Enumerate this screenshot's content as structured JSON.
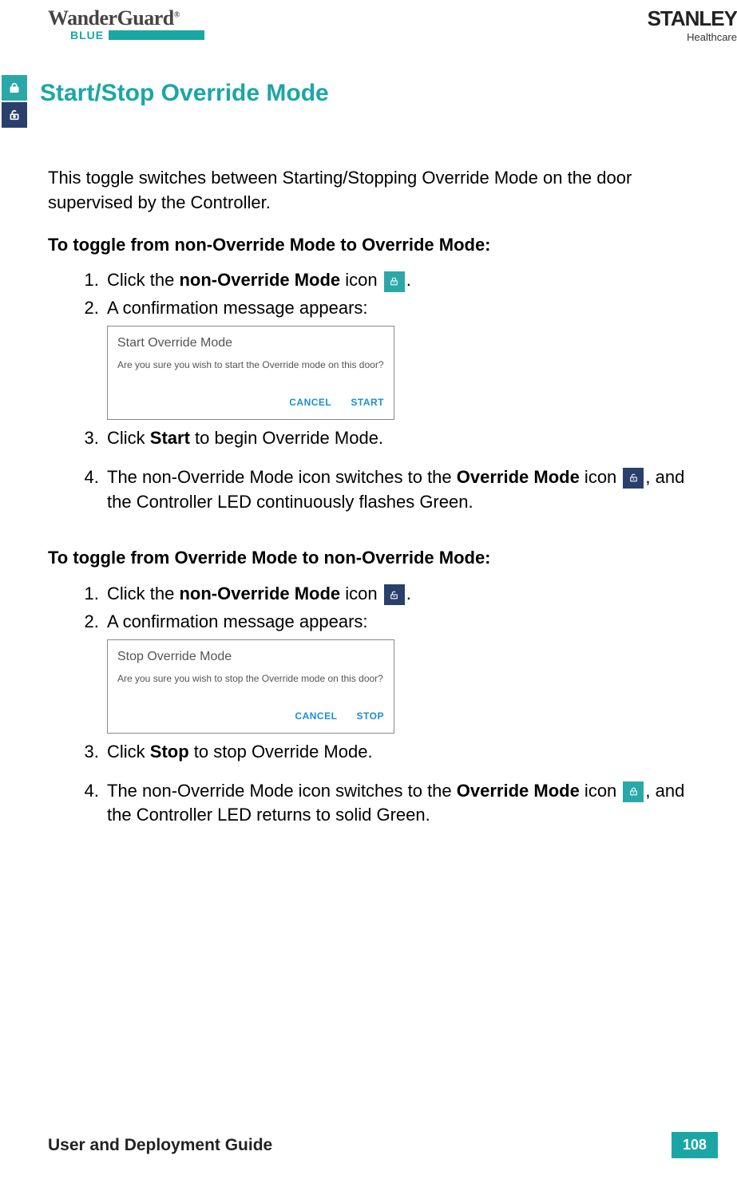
{
  "header": {
    "logo_left_main": "WanderGuard",
    "logo_left_reg": "®",
    "logo_left_sub": "BLUE",
    "logo_right_main": "STANLEY",
    "logo_right_sub": "Healthcare"
  },
  "title": "Start/Stop Override Mode",
  "intro": "This toggle switches between Starting/Stopping Override Mode on the door supervised by the Controller.",
  "section_a": {
    "heading": "To toggle from non-Override Mode to Override Mode:",
    "step1_pre": "Click the ",
    "step1_bold": "non-Override Mode",
    "step1_post": " icon ",
    "step1_end": ".",
    "step2": "A confirmation message appears:",
    "dialog": {
      "title": "Start Override Mode",
      "body": "Are you sure you wish to start the Override mode on this door?",
      "cancel": "CANCEL",
      "action": "START"
    },
    "step3_pre": "Click ",
    "step3_bold": "Start",
    "step3_post": " to begin Override Mode.",
    "step4_pre": "The non-Override Mode icon switches to the ",
    "step4_bold": "Override Mode",
    "step4_mid": " icon ",
    "step4_end": ", and the Controller LED continuously flashes Green."
  },
  "section_b": {
    "heading": "To toggle from Override Mode to non-Override Mode:",
    "step1_pre": "Click the ",
    "step1_bold": "non-Override Mode",
    "step1_post": " icon ",
    "step1_end": ".",
    "step2": "A confirmation message appears:",
    "dialog": {
      "title": "Stop Override Mode",
      "body": "Are you sure you wish to stop the Override mode on this door?",
      "cancel": "CANCEL",
      "action": "STOP"
    },
    "step3_pre": "Click ",
    "step3_bold": "Stop",
    "step3_post": " to stop Override Mode.",
    "step4_pre": "The non-Override Mode icon switches to the ",
    "step4_bold": "Override Mode",
    "step4_mid": " icon ",
    "step4_end": ", and the Controller LED returns to solid Green."
  },
  "footer": {
    "title": "User and Deployment Guide",
    "page": "108"
  }
}
